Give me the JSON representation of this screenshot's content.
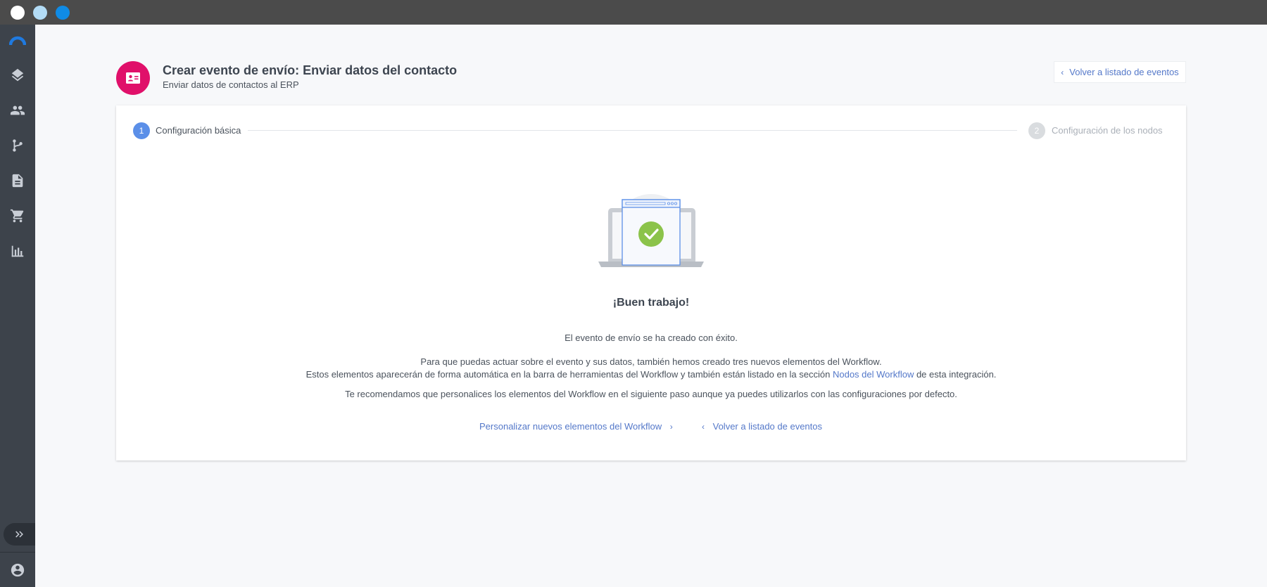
{
  "window": {
    "controls": [
      {
        "name": "close",
        "color": "#ffffff"
      },
      {
        "name": "minimize",
        "color": "#b3dcf6"
      },
      {
        "name": "maximize",
        "color": "#0f8be6"
      }
    ]
  },
  "sidebar": {
    "items": [
      {
        "icon": "brand-logo-icon"
      },
      {
        "icon": "layers-icon"
      },
      {
        "icon": "people-icon"
      },
      {
        "icon": "workflow-branch-icon"
      },
      {
        "icon": "document-icon"
      },
      {
        "icon": "shopping-cart-icon"
      },
      {
        "icon": "bar-chart-icon"
      }
    ],
    "expand_icon": "double-chevron-right-icon",
    "user_icon": "account-circle-icon"
  },
  "header": {
    "icon": "contact-card-icon",
    "icon_color": "#e0106a",
    "title": "Crear evento de envío: Enviar datos del contacto",
    "subtitle": "Enviar datos de contactos al ERP",
    "back_button": "Volver a listado de eventos"
  },
  "stepper": {
    "steps": [
      {
        "number": "1",
        "label": "Configuración básica",
        "state": "active"
      },
      {
        "number": "2",
        "label": "Configuración de los nodos",
        "state": "inactive"
      }
    ],
    "active_color": "#5b8fe8",
    "inactive_color": "#d9dcdf"
  },
  "success": {
    "illustration_icon": "laptop-success-icon",
    "check_color": "#8bc34a",
    "heading": "¡Buen trabajo!",
    "line1": "El evento de envío se ha creado con éxito.",
    "line2": "Para que puedas actuar sobre el evento y sus datos, también hemos creado tres nuevos elementos del Workflow.",
    "line3_before": "Estos elementos aparecerán de forma automática en la barra de herramientas del Workflow y también están listado en la sección ",
    "line3_link": "Nodos del Workflow",
    "line3_after": " de esta integración.",
    "line4": "Te recomendamos que personalices los elementos del Workflow en el siguiente paso aunque ya puedes utilizarlos con las configuraciones por defecto.",
    "action_customize": "Personalizar nuevos elementos del Workflow",
    "action_back": "Volver a listado de eventos"
  },
  "colors": {
    "link": "#5478c9",
    "sidebar_bg": "#3d434b",
    "titlebar_bg": "#4b4b4b"
  }
}
